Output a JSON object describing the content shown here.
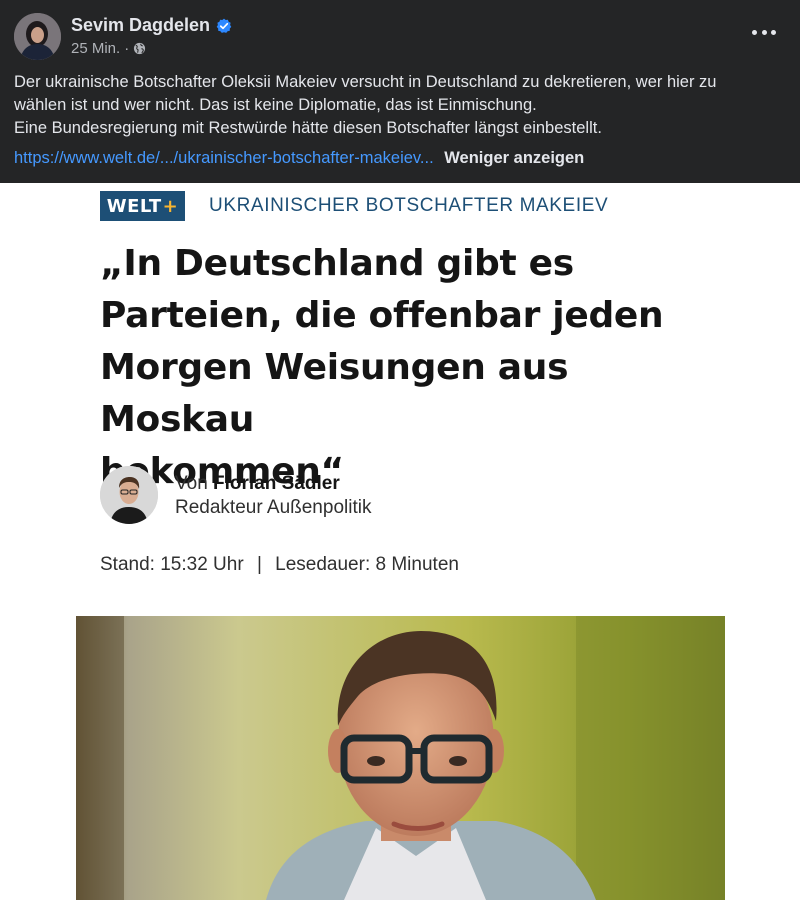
{
  "post": {
    "author": "Sevim Dagdelen",
    "time": "25 Min.",
    "separator": "·",
    "text_lines": [
      "Der ukrainische Botschafter Oleksii Makeiev versucht in Deutschland zu dekretieren, wer hier zu",
      "wählen ist und wer nicht. Das ist keine Diplomatie, das ist Einmischung.",
      "Eine Bundesregierung mit Restwürde hätte diesen Botschafter längst einbestellt."
    ],
    "link_text": "https://www.welt.de/.../ukrainischer-botschafter-makeiev...",
    "show_less": "Weniger anzeigen",
    "icons": [
      "verified-badge-icon",
      "globe-icon",
      "more-options-icon"
    ]
  },
  "article": {
    "logo_text": "WELT",
    "logo_plus": "+",
    "topic": "UKRAINISCHER BOTSCHAFTER MAKEIEV",
    "headline_lines": [
      "„In Deutschland gibt es",
      "Parteien, die offenbar jeden",
      "Morgen Weisungen aus Moskau",
      "bekommen“"
    ],
    "byline_prefix": "Von",
    "author_name": "Florian Sädler",
    "author_role": "Redakteur Außenpolitik",
    "stand": "Stand: 15:32 Uhr",
    "stand_separator": "|",
    "reading_time": "Lesedauer: 8 Minuten"
  },
  "colors": {
    "post_bg": "#242526",
    "link": "#4599ff",
    "welt_blue": "#1d4f76",
    "welt_plus": "#f8b531",
    "verified": "#2d88ff"
  }
}
